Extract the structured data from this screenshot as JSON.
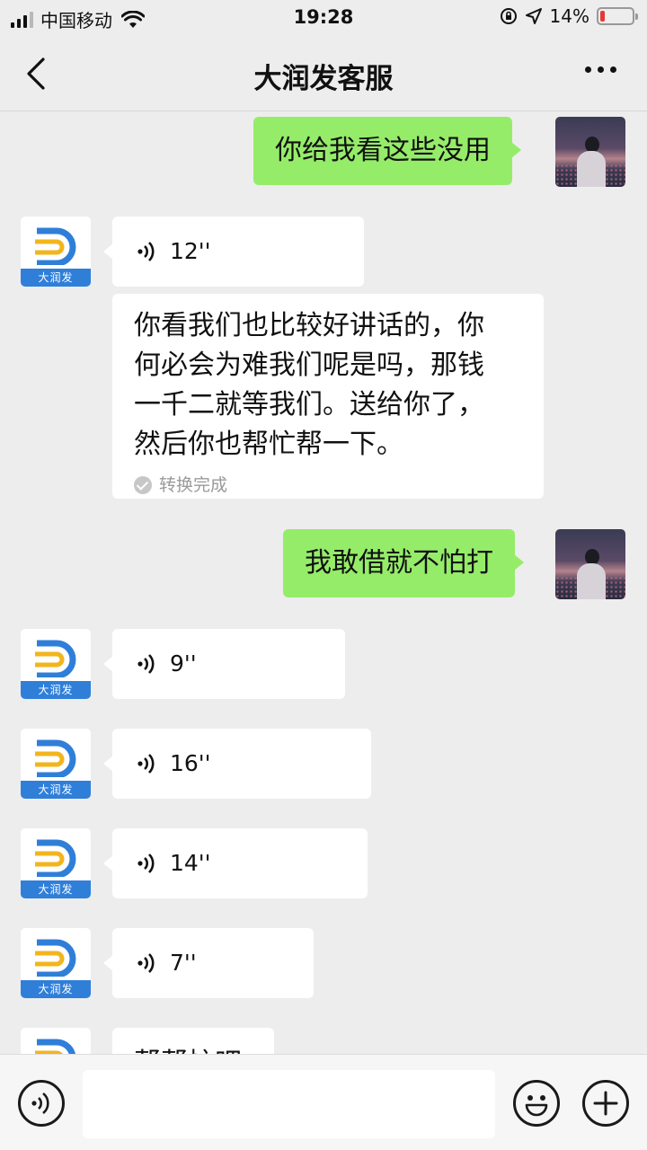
{
  "status_bar": {
    "carrier": "中国移动",
    "time": "19:28",
    "battery_percent": "14%",
    "battery_level": 0.14,
    "battery_color": "#e53935"
  },
  "header": {
    "title": "大润发客服",
    "back_icon": "chevron-left-icon",
    "more_icon": "more-dots-icon"
  },
  "bot": {
    "avatar_label": "大润发",
    "brand_color": "#2f7fd9",
    "accent_color": "#f2b51c"
  },
  "messages": [
    {
      "from": "user",
      "type": "text",
      "text": "你给我看这些没用"
    },
    {
      "from": "bot",
      "type": "voice",
      "duration": "12''"
    },
    {
      "from": "bot",
      "type": "text",
      "lines": [
        "你看我们也比较好讲话的，你",
        "何必会为难我们呢是吗，那钱",
        "一千二就等我们。送给你了，",
        "然后你也帮忙帮一下。"
      ],
      "status": "转换完成"
    },
    {
      "from": "user",
      "type": "text",
      "text": "我敢借就不怕打"
    },
    {
      "from": "bot",
      "type": "voice",
      "duration": "9''"
    },
    {
      "from": "bot",
      "type": "voice",
      "duration": "16''"
    },
    {
      "from": "bot",
      "type": "voice",
      "duration": "14''"
    },
    {
      "from": "bot",
      "type": "voice",
      "duration": "7''"
    },
    {
      "from": "bot",
      "type": "text",
      "text": "帮帮忙吧"
    }
  ],
  "colors": {
    "sent_bubble": "#95ec69",
    "received_bubble": "#ffffff",
    "background": "#ededed"
  },
  "input_bar": {
    "voice_icon": "voice-input-icon",
    "emoji_icon": "emoji-icon",
    "add_icon": "plus-icon",
    "input_value": ""
  }
}
